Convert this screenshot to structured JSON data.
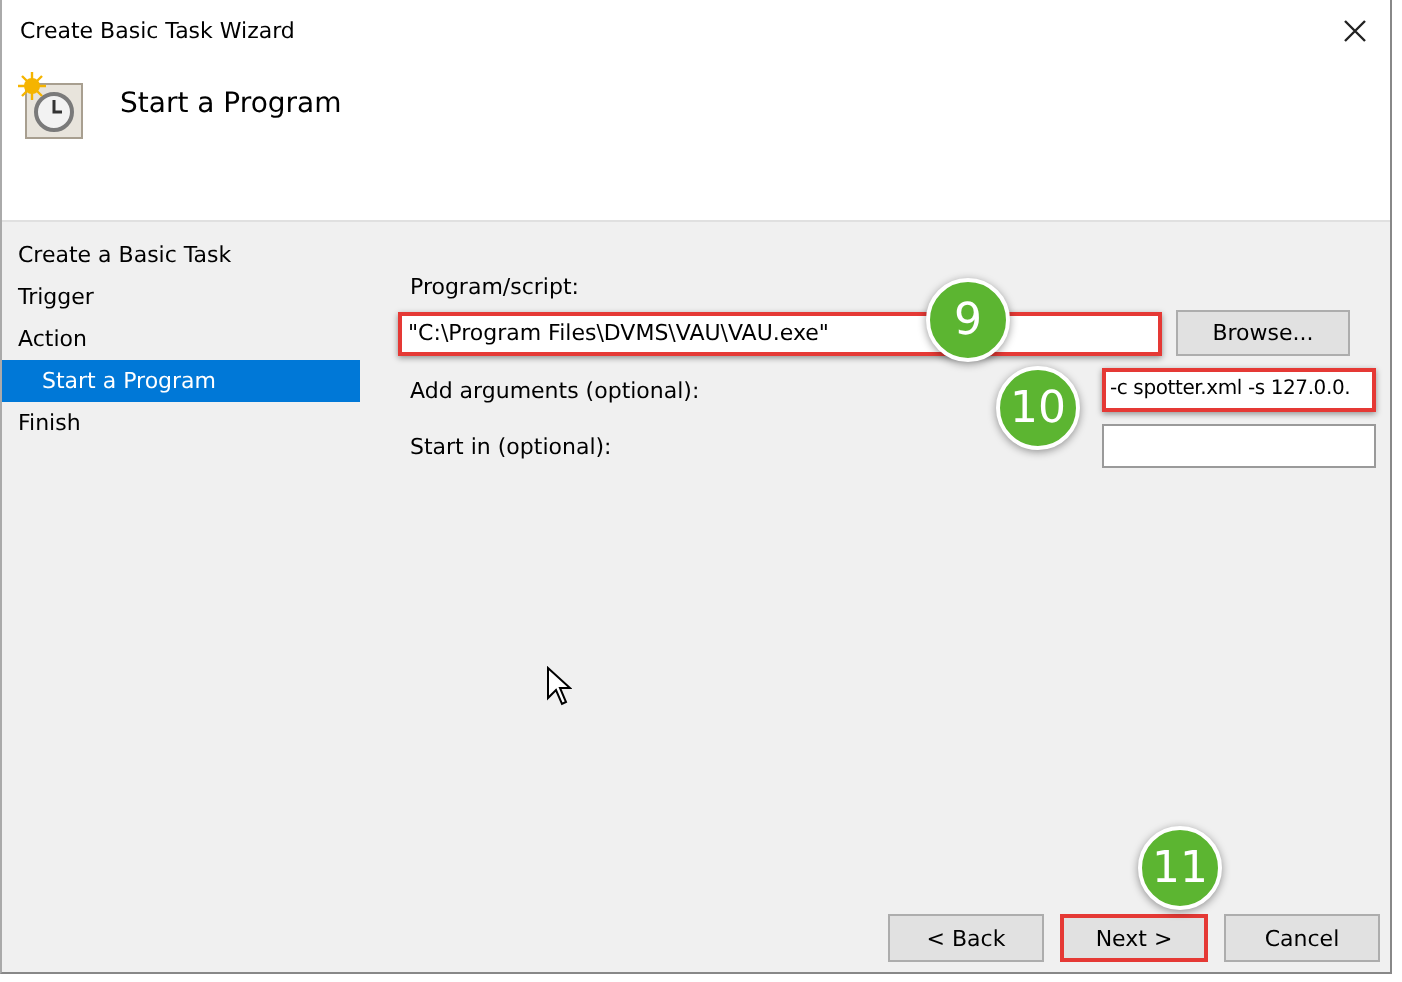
{
  "window": {
    "title": "Create Basic Task Wizard"
  },
  "header": {
    "title": "Start a Program"
  },
  "steps": [
    {
      "label": "Create a Basic Task",
      "selected": false
    },
    {
      "label": "Trigger",
      "selected": false
    },
    {
      "label": "Action",
      "selected": false,
      "children": [
        {
          "label": "Start a Program",
          "selected": true
        }
      ]
    },
    {
      "label": "Finish",
      "selected": false
    }
  ],
  "program": {
    "label": "Program/script:",
    "value": "\"C:\\Program Files\\DVMS\\VAU\\VAU.exe\"",
    "highlighted": true,
    "callout": "9",
    "browse": "Browse..."
  },
  "fields": [
    {
      "label": "Add arguments (optional):",
      "value": "-c spotter.xml -s 127.0.0.",
      "highlighted": true,
      "callout": "10"
    },
    {
      "label": "Start in (optional):",
      "highlighted": false
    }
  ],
  "buttons": [
    {
      "label": "< Back",
      "highlighted": false
    },
    {
      "label": "Next >",
      "highlighted": true,
      "callout": "11"
    },
    {
      "label": "Cancel",
      "highlighted": false
    }
  ]
}
